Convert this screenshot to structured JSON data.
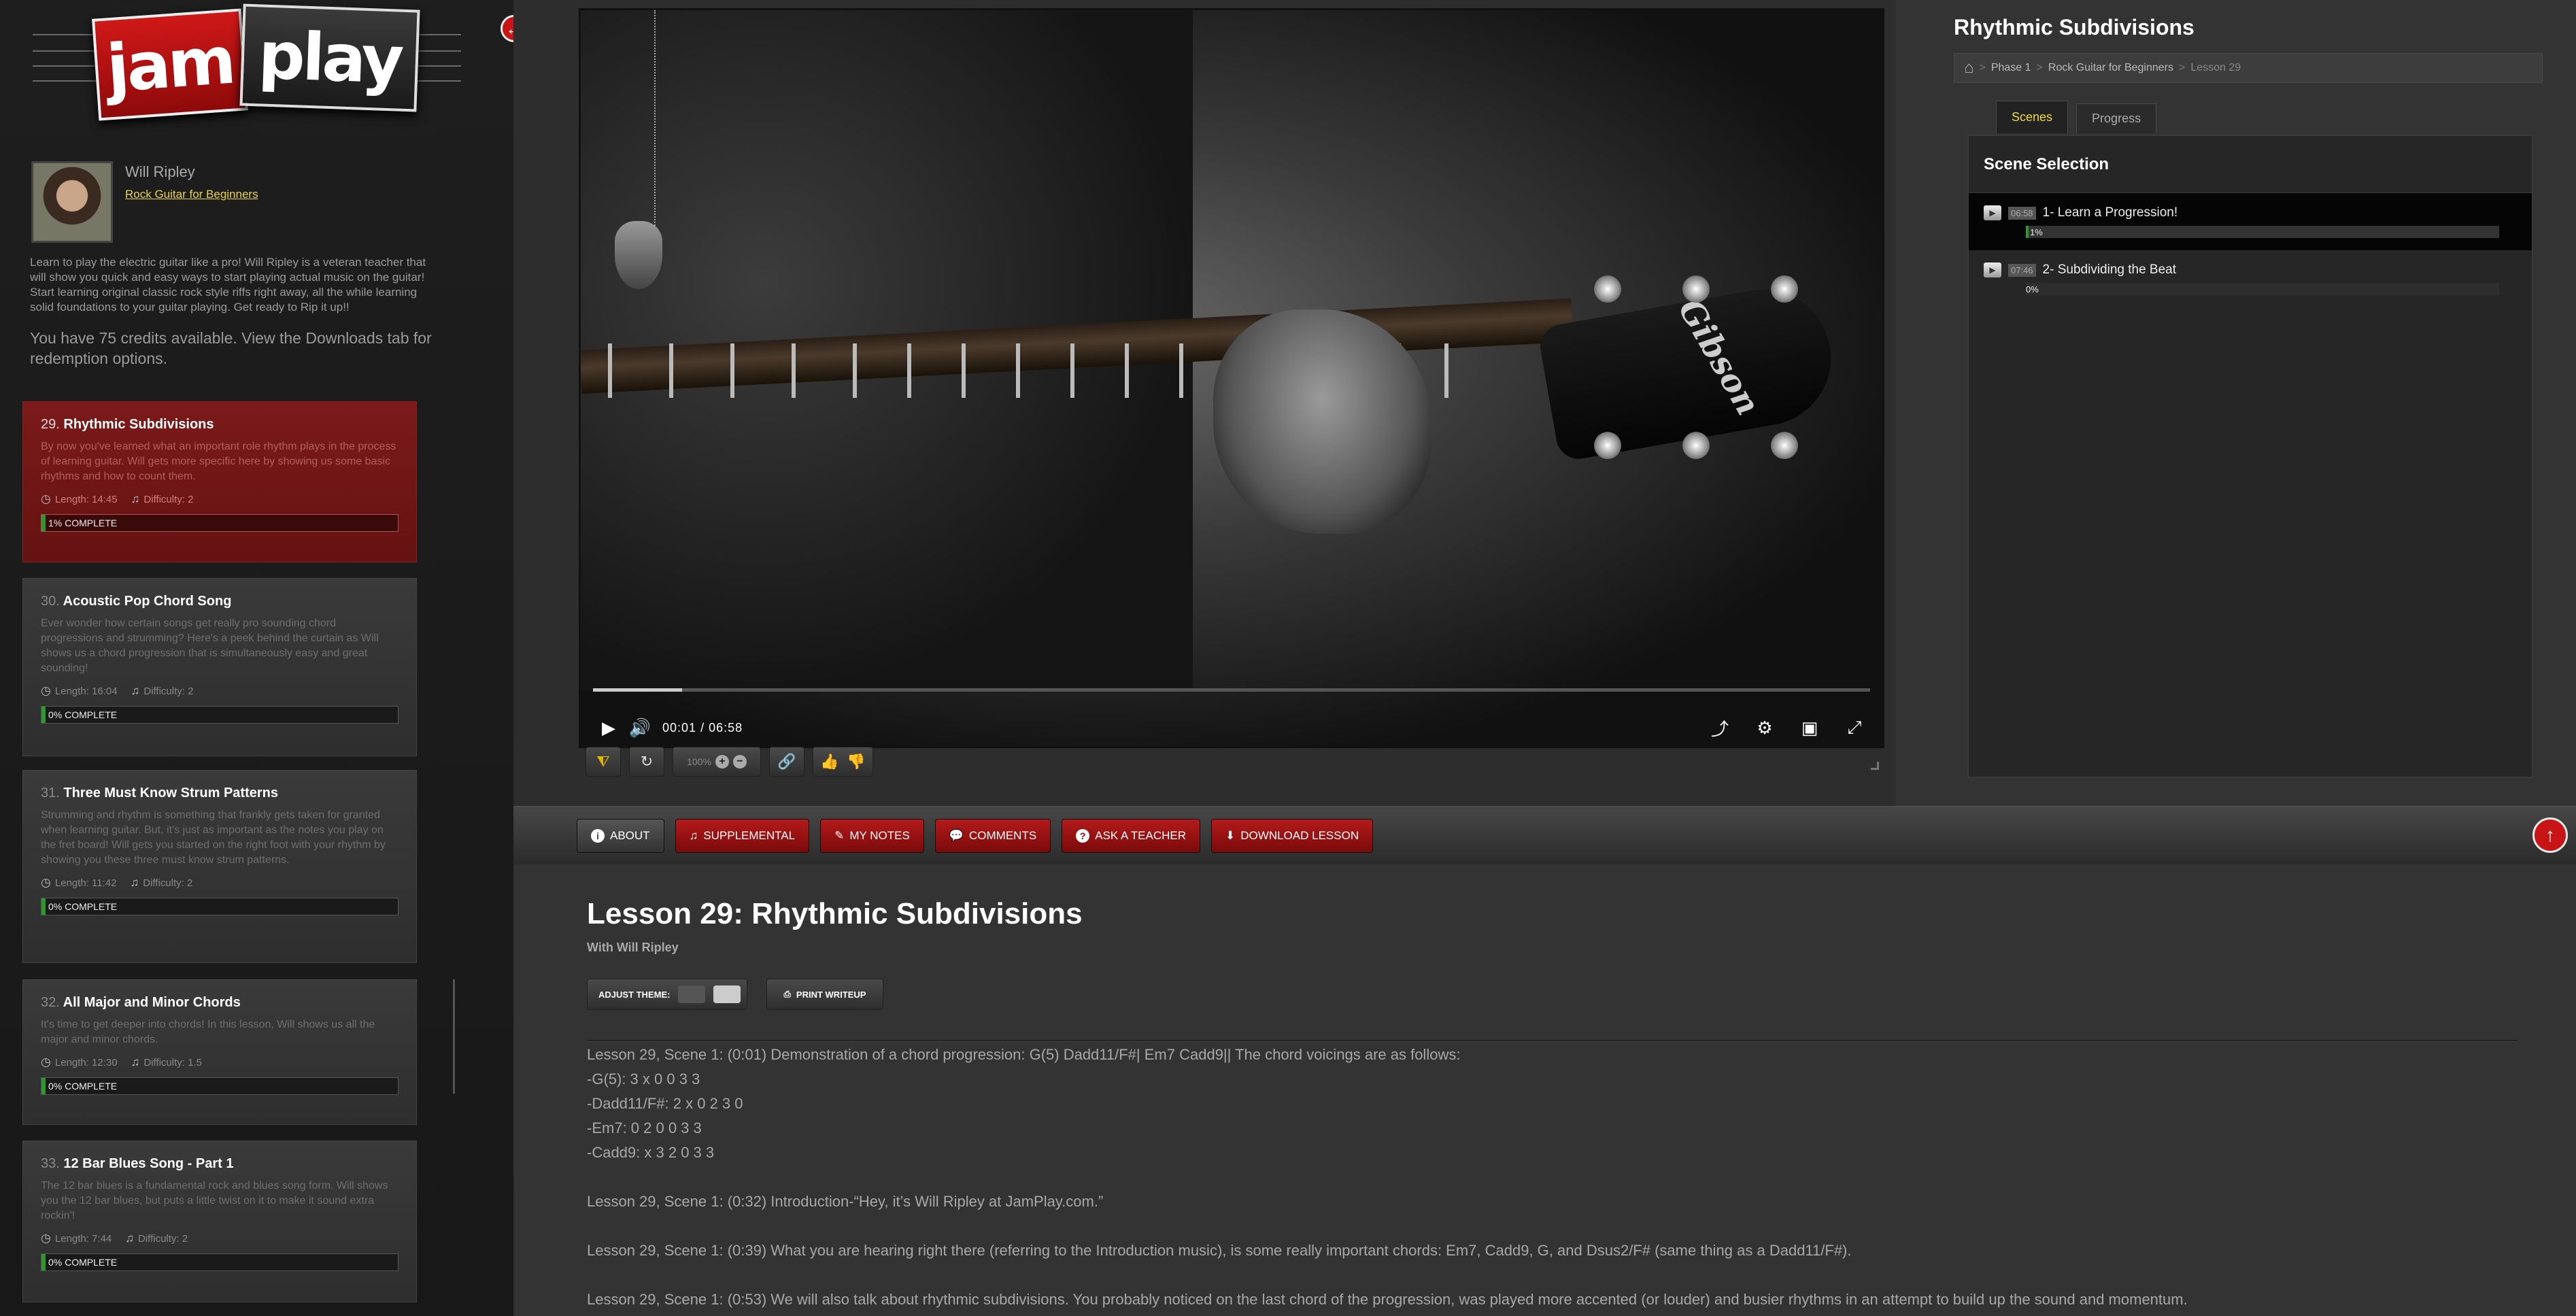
{
  "logo": {
    "left": "jam",
    "right": "play"
  },
  "teacher": {
    "name": "Will Ripley",
    "course": "Rock Guitar for Beginners"
  },
  "course_desc": "Learn to play the electric guitar like a pro! Will Ripley is a veteran teacher that will show you quick and easy ways to start playing actual music on the guitar! Start learning original classic rock style riffs right away, all the while learning solid foundations to your guitar playing. Get ready to Rip it up!!",
  "credits": "You have 75 credits available. View the Downloads tab for redemption options.",
  "lessons": [
    {
      "num": "29.",
      "title": "Rhythmic Subdivisions",
      "desc": "By now you've learned what an important role rhythm plays in the process of learning guitar. Will gets more specific here by showing us some basic rhythms and how to count them.",
      "length": "Length: 14:45",
      "difficulty": "Difficulty: 2",
      "progress": "1% COMPLETE"
    },
    {
      "num": "30.",
      "title": "Acoustic Pop Chord Song",
      "desc": "Ever wonder how certain songs get really pro sounding chord progressions and strumming? Here's a peek behind the curtain as Will shows us a chord progression that is simultaneously easy and great sounding!",
      "length": "Length: 16:04",
      "difficulty": "Difficulty: 2",
      "progress": "0% COMPLETE"
    },
    {
      "num": "31.",
      "title": "Three Must Know Strum Patterns",
      "desc": "Strumming and rhythm is something that frankly gets taken for granted when learning guitar. But, it's just as important as the notes you play on the fret board! Will gets you started on the right foot with your rhythm by showing you these three must know strum patterns.",
      "length": "Length: 11:42",
      "difficulty": "Difficulty: 2",
      "progress": "0% COMPLETE"
    },
    {
      "num": "32.",
      "title": "All Major and Minor Chords",
      "desc": "It's time to get deeper into chords! In this lesson, Will shows us all the major and minor chords.",
      "length": "Length: 12:30",
      "difficulty": "Difficulty: 1.5",
      "progress": "0% COMPLETE"
    },
    {
      "num": "33.",
      "title": "12 Bar Blues Song - Part 1",
      "desc": "The 12 bar blues is a fundamental rock and blues song form. Will shows you the 12 bar blues, but puts a little twist on it to make it sound extra rockin'!",
      "length": "Length: 7:44",
      "difficulty": "Difficulty: 2",
      "progress": "0% COMPLETE"
    }
  ],
  "video": {
    "current_time": "00:01",
    "separator": "/",
    "duration": "06:58",
    "played_fraction": 0.07,
    "zoom": "100%",
    "brand": "Gibson"
  },
  "right_panel": {
    "title": "Rhythmic Subdivisions",
    "breadcrumb": [
      "Phase 1",
      "Rock Guitar for Beginners",
      "Lesson 29"
    ],
    "tabs": [
      "Scenes",
      "Progress"
    ],
    "scene_header": "Scene Selection",
    "scenes": [
      {
        "duration": "06:58",
        "title": "1- Learn a Progression!",
        "progress": "1%"
      },
      {
        "duration": "07:46",
        "title": "2- Subdividing the Beat",
        "progress": "0%"
      }
    ]
  },
  "tabbar": {
    "about": "ABOUT",
    "supplemental": "SUPPLEMENTAL",
    "notes": "MY NOTES",
    "comments": "COMMENTS",
    "ask": "ASK A TEACHER",
    "download": "DOWNLOAD LESSON"
  },
  "content": {
    "heading": "Lesson 29: Rhythmic Subdivisions",
    "with": "With Will Ripley",
    "theme_label": "ADJUST THEME:",
    "print_label": "PRINT WRITEUP",
    "writeup": [
      "Lesson 29, Scene 1: (0:01) Demonstration of a chord progression: G(5) Dadd11/F#| Em7 Cadd9|| The chord voicings are as follows:",
      "-G(5): 3 x 0 0 3 3",
      "-Dadd11/F#: 2 x 0 2 3 0",
      "-Em7: 0 2 0 0 3 3",
      "-Cadd9: x 3 2 0 3 3",
      "Lesson 29, Scene 1: (0:32) Introduction-“Hey, it’s Will Ripley at JamPlay.com.”",
      "Lesson 29, Scene 1: (0:39) What you are hearing right there (referring to the Introduction music), is some really important chords: Em7, Cadd9, G, and Dsus2/F# (same thing as a Dadd11/F#).",
      "Lesson 29, Scene 1: (0:53) We will also talk about rhythmic subdivisions. You probably noticed on the last chord of the progression, was played more accented (or louder) and busier rhythms in an attempt to build up the sound and momentum."
    ]
  },
  "colors": {
    "accent_red": "#c81414",
    "highlight_yellow": "#f0dc3a",
    "progress_green": "#2a9a2a"
  }
}
